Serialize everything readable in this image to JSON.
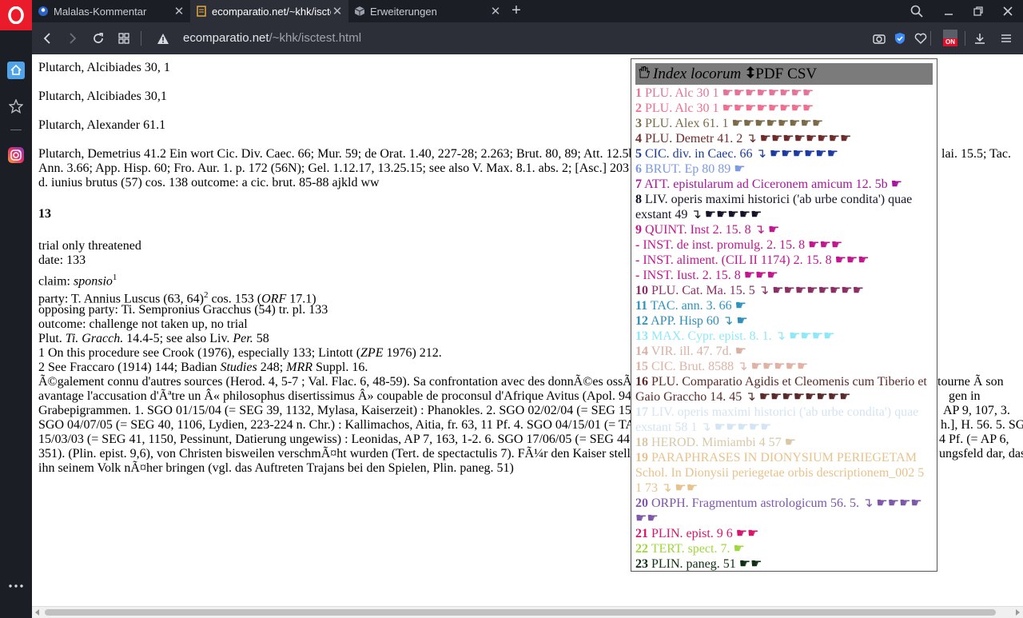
{
  "tabs": [
    {
      "title": "Malalas-Kommentar",
      "icon": "blue-person-icon"
    },
    {
      "title": "ecomparatio.net/~khk/iscte",
      "icon": "page-icon"
    },
    {
      "title": "Erweiterungen",
      "icon": "cube-icon"
    }
  ],
  "address": {
    "domain": "ecomparatio.net",
    "path": "/~khk/isctest.html"
  },
  "vpn_badge": "ON",
  "content": {
    "lines": [
      "Plutarch, Alcibiades 30, 1",
      "Plutarch, Alcibiades 30,1",
      "Plutarch, Alexander 61.1",
      "Plutarch, Demetrius 41.2 Ein wort Cic. Div. Caec. 66; Mur. 59; de Orat. 1.40, 227-28; 2.263; Brut. 80, 89; Att. 12.5b",
      "Ann. 3.66; App. Hisp. 60; Fro. Aur. 1. p. 172 (56N); Gel. 1.12.17, 13.25.15; see also V. Max. 8.1. abs. 2; [Asc.] 203",
      "d. iunius brutus (57) cos. 138 outcome: a cic. brut. 85-88 ajkld ww",
      "lai. 15.5; Tac.",
      "13",
      "trial only threatened",
      "date: 133",
      "outcome: challenge not taken up, no trial",
      "opposing party: Ti. Sempronius Gracchus (54) tr. pl. 133",
      "1 On this procedure see Crook (1976), especially 133; Lintott (",
      "ZPE",
      " 1976) 212.",
      "2 See Fraccaro (1914) 144; Badian ",
      "Studies",
      " 248; ",
      "MRR",
      " Suppl. 16.",
      "Ã©galement connu d'autres sources (Herod. 4, 5-7 ; Val. Flac. 6, 48-59). Sa confrontation avec des donnÃ©es ossÃ",
      "avantage l'accusation d'Ãªtre un Â« philosophus disertissimus Â» coupable de proconsul d'Afrique Avitus (Apol. 94",
      "Grabepigrammen. 1. SGO 01/15/04 (= SEG 39, 1132, Mylasa, Kaiserzeit) : Phanokles. 2. SGO 02/02/04 (= SEG 15",
      "SGO 04/07/05 (= SEG 40, 1106, Lydien, 223-224 n. Chr.) : Kallimachos, Aitia, fr. 63, 11 Pf. 4. SGO 04/15/01 (= TA",
      "15/03/03 (= SEG 41, 1150, Pessinunt, Datierung ungewiss) : Leonidas, AP 7, 163, 1-2. 6. SGO 17/06/05 (= SEG 44",
      "351). (Plin. epist. 9,6), von Christen bisweilen verschmÃ¤ht wurden (Tert. de spectactulis 7). FÃ¼r den Kaiser stell",
      "ihn seinem Volk nÃ¤her bringen (vgl. das Auftreten Trajans bei den Spielen, Plin. paneg. 51)",
      "tourne Ã  son",
      "gen in",
      "AP 9, 107, 3.",
      "h.], H. 56. 5. SGO",
      "4 Pf. (= AP 6,",
      "ungsfeld dar, das"
    ],
    "claim_label": "claim: ",
    "claim_value": "sponsio",
    "claim_sup": "1",
    "party_text": "party: T. Annius Luscus (63, 64)",
    "party_sup": "2",
    "party_after": " cos. 153 (",
    "party_orf": "ORF",
    "party_end": " 17.1)",
    "plut_prefix": "Plut. ",
    "plut_italic": "Ti. Gracch.",
    "plut_mid": " 14.4-5; see also Liv. ",
    "plut_per": "Per.",
    "plut_end": " 58"
  },
  "index": {
    "icon": "hand-icon",
    "title": "Index locorum",
    "sort_icon": "updown-arrow-icon",
    "pdf": "PDF",
    "csv": "CSV",
    "entries": [
      {
        "num": "1",
        "text": "PLU. Alc 30 1",
        "hands": "☛☛☛☛☛☛☛☛",
        "color": "#e4739a"
      },
      {
        "num": "2",
        "text": "PLU. Alc 30 1",
        "hands": "☛☛☛☛☛☛☛☛",
        "color": "#f06e8f"
      },
      {
        "num": "3",
        "text": "PLU. Alex 61. 1",
        "hands": "☛☛☛☛☛☛☛☛",
        "color": "#7a6a48"
      },
      {
        "num": "4",
        "text": "PLU. Demetr 41. 2 ↴",
        "hands": "☛☛☛☛☛☛☛☛",
        "color": "#6d2b2b"
      },
      {
        "num": "5",
        "text": "CIC. div. in Caec. 66 ↴",
        "hands": "☛☛☛☛☛☛",
        "color": "#1c3aa0"
      },
      {
        "num": "6",
        "text": "BRUT. Ep 80 89",
        "hands": "☛",
        "color": "#7c9ae0"
      },
      {
        "num": "7",
        "text": "ATT. epistularum ad Ciceronem amicum 12. 5b",
        "hands": "☛",
        "color": "#a8159c"
      },
      {
        "num": "8",
        "text": "LIV. operis maximi historici ('ab urbe condita') quae exstant 49 ↴",
        "hands": "☛☛☛☛☛",
        "color": "#141428"
      },
      {
        "num": "9",
        "text": "QUINT. Inst 2. 15. 8 ↴",
        "hands": "☛",
        "color": "#c0178e"
      },
      {
        "num": "-",
        "text": "INST. de inst. promulg. 2. 15. 8",
        "hands": "☛☛☛",
        "color": "#c0178e"
      },
      {
        "num": "-",
        "text": "INST. aliment. (CIL II 1174) 2. 15. 8",
        "hands": "☛☛☛",
        "color": "#c0178e"
      },
      {
        "num": "-",
        "text": "INST. Iust. 2. 15. 8",
        "hands": "☛☛☛",
        "color": "#c0178e"
      },
      {
        "num": "10",
        "text": "PLU. Cat. Ma. 15. 5 ↴",
        "hands": "☛☛☛☛☛☛☛☛",
        "color": "#8a2f64"
      },
      {
        "num": "11",
        "text": "TAC. ann. 3. 66",
        "hands": "☛",
        "color": "#2f93c0"
      },
      {
        "num": "12",
        "text": "APP. Hisp 60 ↴",
        "hands": "☛",
        "color": "#2f8fb8"
      },
      {
        "num": "13",
        "text": "MAX. Cypr. epist. 8. 1. ↴",
        "hands": "☛☛☛☛",
        "color": "#8fe8f8"
      },
      {
        "num": "14",
        "text": "VIR. ill. 47. 7d.",
        "hands": "☛",
        "color": "#d9b0a4"
      },
      {
        "num": "15",
        "text": "CIC. Brut. 8588 ↴",
        "hands": "☛☛☛☛☛",
        "color": "#e0b2a4"
      },
      {
        "num": "16",
        "text": "PLU. Comparatio Agidis et Cleomenis cum Tiberio et Gaio Graccho 14. 45 ↴",
        "hands": "☛☛☛☛☛☛☛☛",
        "color": "#5a2a2a"
      },
      {
        "num": "17",
        "text": "LIV. operis maximi historici ('ab urbe condita') quae exstant 58 1 ↴",
        "hands": "☛☛☛☛☛",
        "color": "#d4e4f2"
      },
      {
        "num": "18",
        "text": "HEROD. Mimiambi 4 57",
        "hands": "☛",
        "color": "#d8c8a8"
      },
      {
        "num": "19",
        "text": "PARAPHRASES IN DIONYSIUM PERIEGETAM Schol. In Dionysii periegetae orbis descriptionem_002 5 1 73 ↴",
        "hands": "☛☛",
        "color": "#e8c28c"
      },
      {
        "num": "20",
        "text": "ORPH. Fragmentum astrologicum 56. 5. ↴",
        "hands": "☛☛☛☛☛☛",
        "color": "#7e58a8"
      },
      {
        "num": "21",
        "text": "PLIN. epist. 9 6",
        "hands": "☛☛",
        "color": "#d8156a"
      },
      {
        "num": "22",
        "text": "TERT. spect. 7.",
        "hands": "☛",
        "color": "#9ed83a"
      },
      {
        "num": "23",
        "text": "PLIN. paneg. 51",
        "hands": "☛☛",
        "color": "#0e2e12"
      }
    ]
  }
}
